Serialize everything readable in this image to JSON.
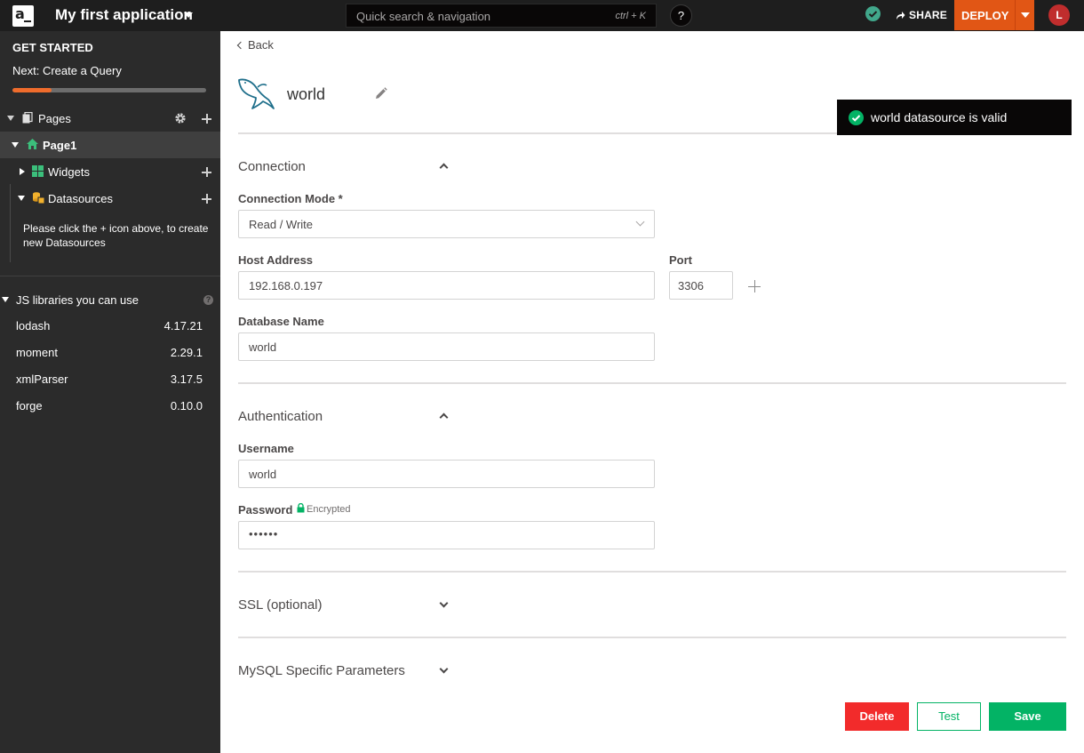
{
  "header": {
    "logo_text": "a",
    "app_name": "My first application",
    "search_placeholder": "Quick search & navigation",
    "search_shortcut": "ctrl + K",
    "help_label": "?",
    "share_label": "SHARE",
    "deploy_label": "DEPLOY",
    "avatar_initial": "L"
  },
  "sidebar": {
    "get_started_title": "GET STARTED",
    "next_step": "Next: Create a Query",
    "onboarding_progress": 0.2,
    "pages_label": "Pages",
    "page1_label": "Page1",
    "widgets_label": "Widgets",
    "datasources_label": "Datasources",
    "datasources_hint": "Please click the + icon above, to create new Datasources",
    "libraries_title": "JS libraries you can use",
    "libraries": [
      {
        "name": "lodash",
        "version": "4.17.21"
      },
      {
        "name": "moment",
        "version": "2.29.1"
      },
      {
        "name": "xmlParser",
        "version": "3.17.5"
      },
      {
        "name": "forge",
        "version": "0.10.0"
      }
    ]
  },
  "main": {
    "back_label": "Back",
    "datasource_name": "world",
    "connection": {
      "title": "Connection",
      "mode_label": "Connection Mode *",
      "mode_value": "Read / Write",
      "host_label": "Host Address",
      "host_value": "192.168.0.197",
      "port_label": "Port",
      "port_value": "3306",
      "db_label": "Database Name",
      "db_value": "world"
    },
    "authentication": {
      "title": "Authentication",
      "username_label": "Username",
      "username_value": "world",
      "password_label": "Password",
      "password_note": "Encrypted",
      "password_value": "••••••"
    },
    "ssl_title": "SSL (optional)",
    "mysql_title": "MySQL Specific Parameters",
    "delete_label": "Delete",
    "test_label": "Test",
    "save_label": "Save"
  },
  "toast": {
    "message": "world datasource is valid"
  },
  "colors": {
    "topbar": "#1e1e1e",
    "sidebar": "#2b2b2b",
    "deploy": "#e15615",
    "progress": "#ef6c2c",
    "success": "#03b365",
    "danger": "#f22b2b"
  }
}
